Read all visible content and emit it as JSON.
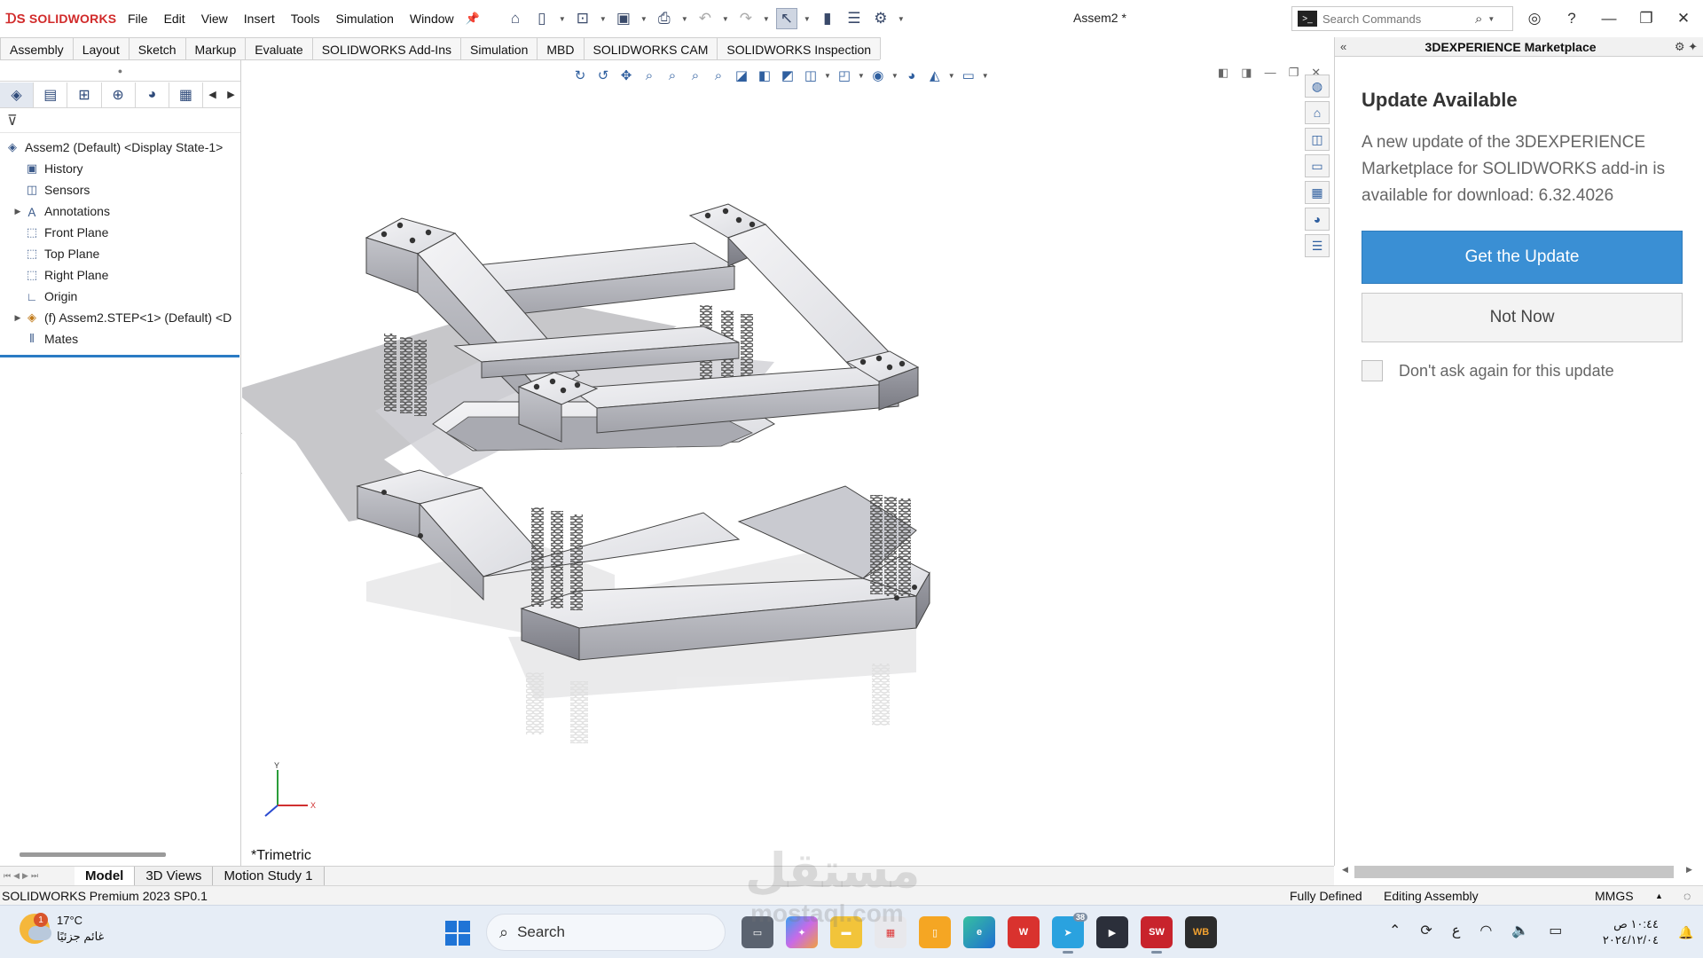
{
  "app": {
    "logo": "SOLIDWORKS",
    "document_title": "Assem2 *",
    "menu": [
      "File",
      "Edit",
      "View",
      "Insert",
      "Tools",
      "Simulation",
      "Window"
    ],
    "search_placeholder": "Search Commands",
    "accent_color": "#3a8fd4",
    "brand_color": "#d12a2a"
  },
  "command_tabs": [
    "Assembly",
    "Layout",
    "Sketch",
    "Markup",
    "Evaluate",
    "SOLIDWORKS Add-Ins",
    "Simulation",
    "MBD",
    "SOLIDWORKS CAM",
    "SOLIDWORKS Inspection"
  ],
  "feature_tree": {
    "root": "Assem2 (Default) <Display State-1>",
    "items": [
      {
        "label": "History",
        "icon": "history-icon",
        "expandable": false
      },
      {
        "label": "Sensors",
        "icon": "sensor-icon",
        "expandable": false
      },
      {
        "label": "Annotations",
        "icon": "annotation-icon",
        "expandable": true
      },
      {
        "label": "Front Plane",
        "icon": "plane-icon",
        "expandable": false
      },
      {
        "label": "Top Plane",
        "icon": "plane-icon",
        "expandable": false
      },
      {
        "label": "Right Plane",
        "icon": "plane-icon",
        "expandable": false
      },
      {
        "label": "Origin",
        "icon": "origin-icon",
        "expandable": false
      },
      {
        "label": "(f) Assem2.STEP<1> (Default) <D",
        "icon": "assembly-icon",
        "expandable": true
      },
      {
        "label": "Mates",
        "icon": "mates-icon",
        "expandable": false
      }
    ]
  },
  "viewport": {
    "view_name": "*Trimetric",
    "triad_x": "X",
    "triad_y": "Y"
  },
  "marketplace": {
    "panel_title": "3DEXPERIENCE Marketplace",
    "heading": "Update Available",
    "message": "A new update of the 3DEXPERIENCE Marketplace for SOLIDWORKS add-in is available for download: 6.32.4026",
    "primary_button": "Get the Update",
    "secondary_button": "Not Now",
    "checkbox_label": "Don't ask again for this update",
    "checkbox_checked": false
  },
  "bottom_tabs": [
    "Model",
    "3D Views",
    "Motion Study 1"
  ],
  "status": {
    "product": "SOLIDWORKS Premium 2023 SP0.1",
    "state": "Fully Defined",
    "mode": "Editing Assembly",
    "units": "MMGS"
  },
  "taskbar": {
    "temperature": "17°C",
    "weather_text": "غائم جزئيًا",
    "weather_badge": "1",
    "search_label": "Search",
    "telegram_badge": "38",
    "lang": "ع",
    "time": "١٠:٤٤ ص",
    "date": "٢٠٢٤/١٢/٠٤",
    "apps": [
      "task-view",
      "copilot",
      "file-explorer",
      "microsoft-store",
      "files",
      "edge",
      "wps-office",
      "telegram",
      "media-player",
      "solidworks-2023",
      "workbench"
    ]
  },
  "watermark": {
    "arabic": "مستقل",
    "latin": "mostaql.com"
  }
}
